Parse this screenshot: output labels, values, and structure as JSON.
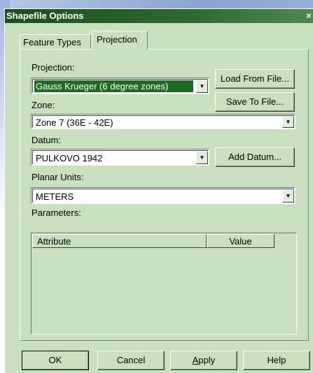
{
  "window": {
    "title": "Shapefile Options",
    "close_label": "×"
  },
  "tabs": [
    {
      "label": "Feature Types",
      "active": false
    },
    {
      "label": "Projection",
      "active": true
    }
  ],
  "projection": {
    "label": "Projection:",
    "value": "Gauss Krueger (6 degree zones)",
    "load_button": "Load From File...",
    "save_button": "Save To File..."
  },
  "zone": {
    "label": "Zone:",
    "value": "Zone 7 (36E - 42E)"
  },
  "datum": {
    "label": "Datum:",
    "value": "PULKOVO 1942",
    "add_button": "Add Datum..."
  },
  "planar_units": {
    "label": "Planar Units:",
    "value": "METERS"
  },
  "parameters": {
    "label": "Parameters:",
    "columns": [
      "Attribute",
      "Value"
    ],
    "rows": []
  },
  "footer": {
    "ok": "OK",
    "cancel": "Cancel",
    "apply_prefix": "A",
    "apply_rest": "pply",
    "help": "Help"
  },
  "icons": {
    "dropdown": "chevron-down-icon"
  }
}
